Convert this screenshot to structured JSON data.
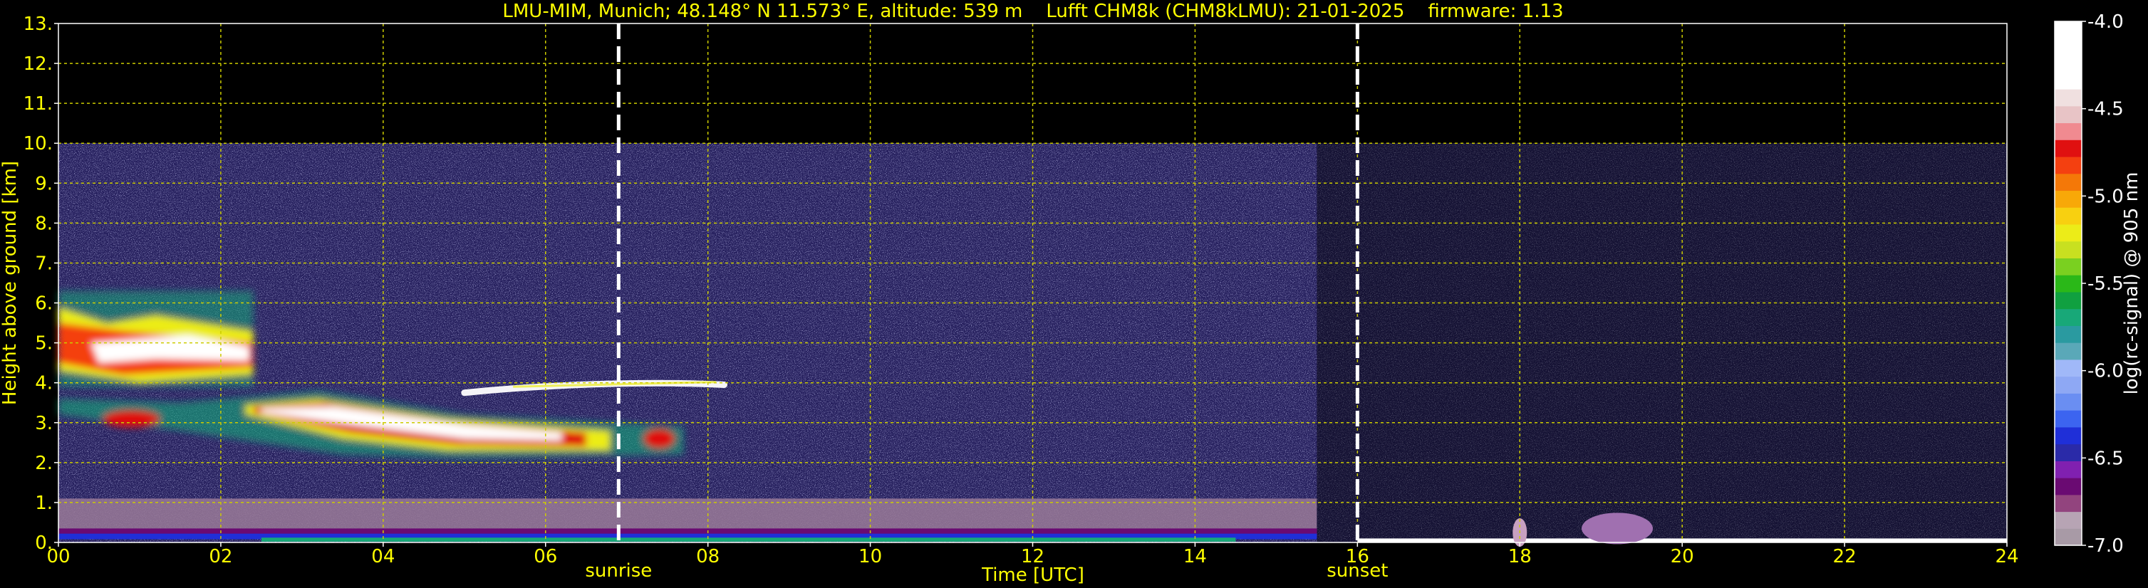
{
  "chart_data": {
    "type": "heatmap",
    "title": "LMU-MIM, Munich; 48.148° N 11.573° E, altitude: 539 m    Lufft CHM8k (CHM8kLMU): 21-01-2025    firmware: 1.13",
    "xlabel": "Time [UTC]",
    "ylabel": "Height above ground [km]",
    "xlim": [
      0,
      24
    ],
    "ylim": [
      0,
      13
    ],
    "x_ticks": [
      "00",
      "02",
      "04",
      "06",
      "08",
      "10",
      "12",
      "14",
      "16",
      "18",
      "20",
      "22",
      "24"
    ],
    "y_ticks": [
      "0.",
      "1.",
      "2.",
      "3.",
      "4.",
      "5.",
      "6.",
      "7.",
      "8.",
      "9.",
      "10.",
      "11.",
      "12.",
      "13."
    ],
    "grid": true,
    "data_max_height_km": 10.0,
    "markers": [
      {
        "label": "sunrise",
        "time_h": 6.9
      },
      {
        "label": "sunset",
        "time_h": 16.0
      }
    ],
    "colorbar": {
      "label": "log(rc-signal) @ 905 nm",
      "range": [
        -7.0,
        -4.0
      ],
      "ticks": [
        "-4.0",
        "-4.5",
        "-5.0",
        "-5.5",
        "-6.0",
        "-6.5",
        "-7.0"
      ],
      "colors": [
        "#a89aa6",
        "#b7a4b4",
        "#92447e",
        "#6a0a72",
        "#8020b0",
        "#2a2aa8",
        "#1f2fd8",
        "#3c64f0",
        "#6a8ef2",
        "#8ea8f4",
        "#a0b8f8",
        "#5aa8b8",
        "#2a9aa0",
        "#18a878",
        "#10a040",
        "#2ab818",
        "#7ad020",
        "#c8e020",
        "#ecec18",
        "#f8d010",
        "#f8a808",
        "#f47808",
        "#f44010",
        "#e01010",
        "#f08a90",
        "#e8c4c6",
        "#f0e0e0",
        "#ffffff",
        "#ffffff",
        "#ffffff",
        "#ffffff"
      ]
    },
    "features": [
      {
        "name": "upper cloud",
        "t_start": 0.0,
        "t_end": 2.4,
        "z_bottom_km": 3.9,
        "z_top_km": 6.3
      },
      {
        "name": "middle cloud layer",
        "t_start": 2.3,
        "t_end": 7.7,
        "z_bottom_km": 2.1,
        "z_top_km": 3.8
      },
      {
        "name": "thin cloud",
        "t_start": 5.0,
        "t_end": 8.2,
        "z_bottom_km": 3.7,
        "z_top_km": 4.1
      },
      {
        "name": "boundary layer",
        "t_start": 0.0,
        "t_end": 15.5,
        "z_bottom_km": 0.0,
        "z_top_km": 1.1
      }
    ]
  }
}
